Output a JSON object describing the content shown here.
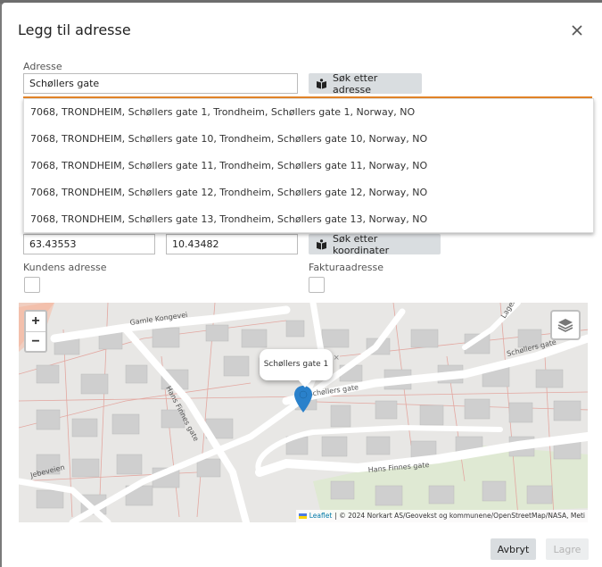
{
  "dialog": {
    "title": "Legg til adresse"
  },
  "address": {
    "label": "Adresse",
    "value": "Schøllers gate",
    "search_button": "Søk etter adresse"
  },
  "suggestions": [
    "7068, TRONDHEIM, Schøllers gate 1, Trondheim, Schøllers gate 1, Norway, NO",
    "7068, TRONDHEIM, Schøllers gate 10, Trondheim, Schøllers gate 10, Norway, NO",
    "7068, TRONDHEIM, Schøllers gate 11, Trondheim, Schøllers gate 11, Norway, NO",
    "7068, TRONDHEIM, Schøllers gate 12, Trondheim, Schøllers gate 12, Norway, NO",
    "7068, TRONDHEIM, Schøllers gate 13, Trondheim, Schøllers gate 13, Norway, NO"
  ],
  "coordinates": {
    "latitude": "63.43553",
    "longitude": "10.43482",
    "search_button": "Søk etter koordinater"
  },
  "checkboxes": {
    "customer_address_label": "Kundens adresse",
    "invoice_address_label": "Fakturaadresse"
  },
  "map": {
    "zoom_in": "+",
    "zoom_out": "−",
    "popup_text": "Schøllers gate 1",
    "popup_close": "×",
    "street_labels": [
      "Gamle Kongevei",
      "Schøllers gate",
      "Schøllers gate",
      "Hans Finnes gate",
      "Hans Finnes gate",
      "Jebeveien",
      "Lager"
    ],
    "attribution_link": "Leaflet",
    "attribution_text": "| © 2024 Norkart AS/Geovekst og kommunene/OpenStreetMap/NASA, Meti"
  },
  "footer": {
    "cancel": "Avbryt",
    "save": "Lagre"
  },
  "colors": {
    "accent": "#e6862a",
    "marker": "#2a81cb",
    "button_bg": "#d9dde0"
  }
}
